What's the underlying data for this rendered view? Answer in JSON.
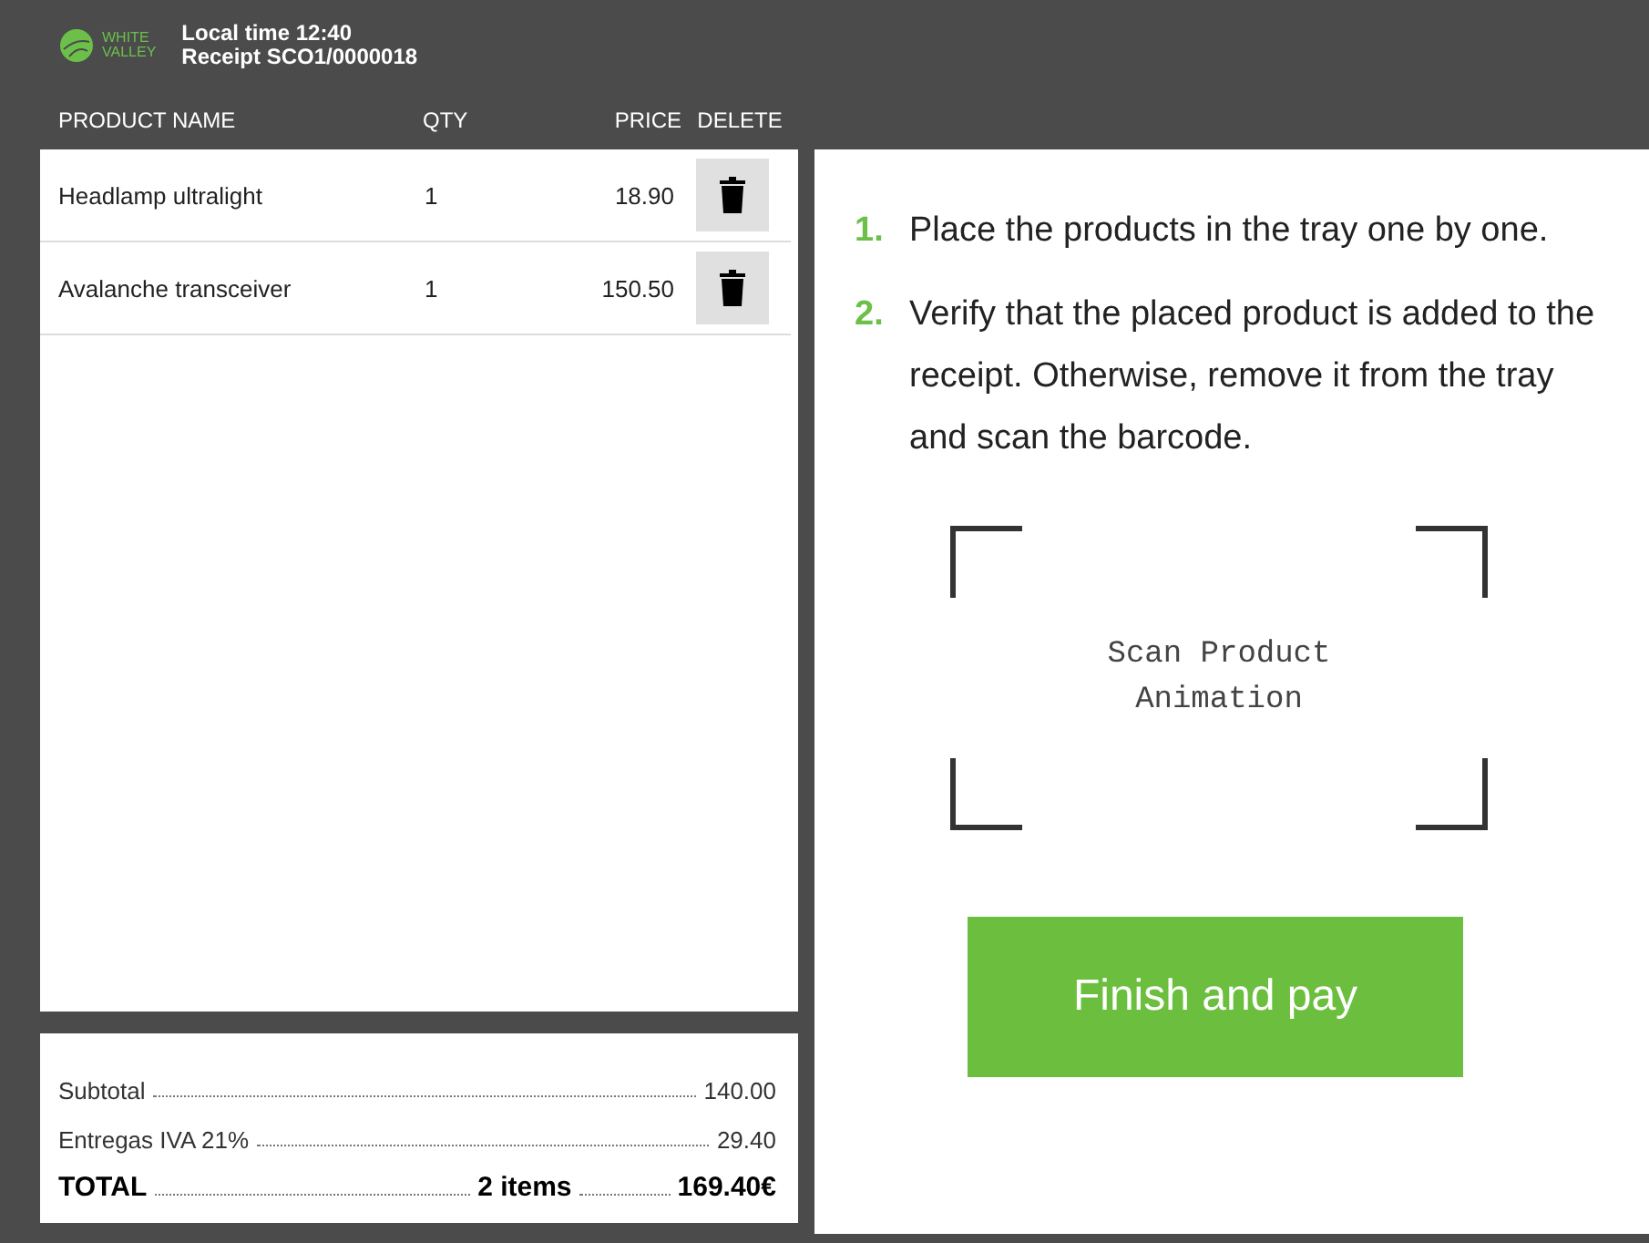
{
  "header": {
    "logo_text": [
      "WHITE",
      "VALLEY"
    ],
    "local_time": "Local time 12:40",
    "receipt": "Receipt SCO1/0000018"
  },
  "columns": [
    "PRODUCT NAME",
    "QTY",
    "PRICE",
    "DELETE"
  ],
  "items": [
    {
      "name": "Headlamp ultralight",
      "qty": "1",
      "price": "18.90"
    },
    {
      "name": "Avalanche transceiver",
      "qty": "1",
      "price": "150.50"
    }
  ],
  "summary": {
    "subtotal_label": "Subtotal",
    "subtotal": "140.00",
    "tax_label": "Entregas IVA 21%",
    "tax": "29.40",
    "total_label": "TOTAL",
    "item_count": "2 items",
    "total": "169.40€"
  },
  "instructions": [
    {
      "number": "1.",
      "text": "Place the products in the tray one by one."
    },
    {
      "number": "2.",
      "text": "Verify that the placed product is added to the receipt. Otherwise, remove it from the tray and scan the barcode."
    }
  ],
  "scan_placeholder": "Scan Product Animation",
  "pay_button": "Finish and pay"
}
